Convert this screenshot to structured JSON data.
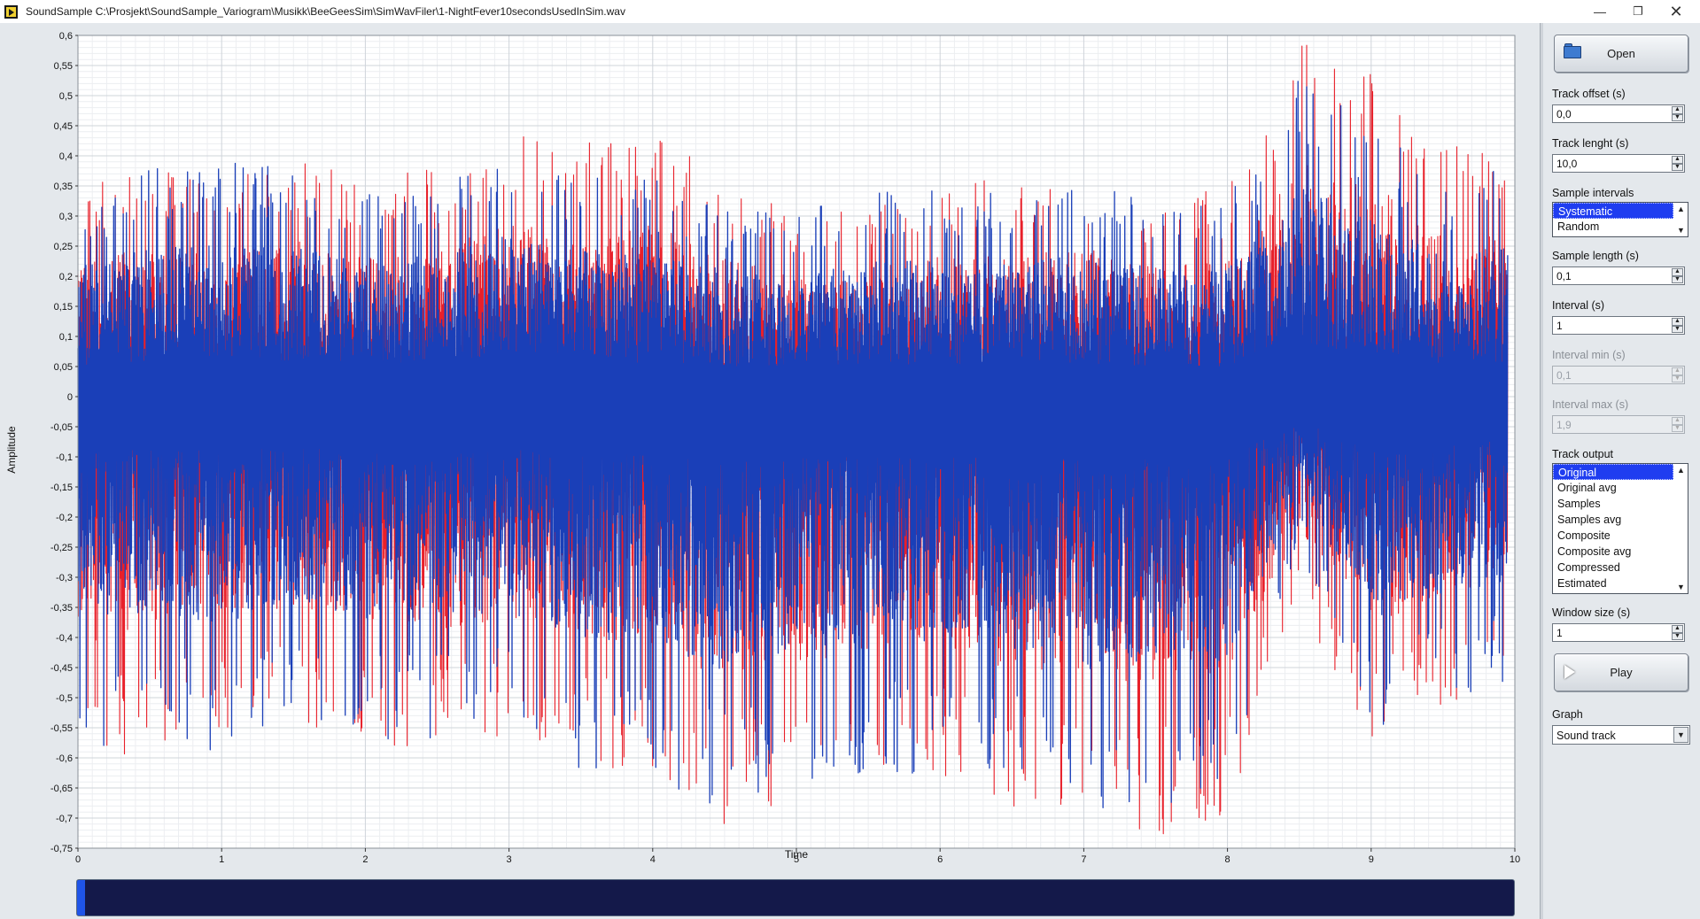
{
  "window": {
    "title": "SoundSample C:\\Prosjekt\\SoundSample_Variogram\\Musikk\\BeeGeesSim\\SimWavFiler\\1-NightFever10secondsUsedInSim.wav",
    "minimize_glyph": "—",
    "maximize_glyph": "❐",
    "close_glyph": "✕"
  },
  "controls": {
    "open_label": "Open",
    "open_icon": "folder-icon",
    "track_offset": {
      "label": "Track offset (s)",
      "value": "0,0"
    },
    "track_length": {
      "label": "Track lenght (s)",
      "value": "10,0"
    },
    "sample_intervals": {
      "label": "Sample intervals",
      "options": [
        "Systematic",
        "Random"
      ],
      "selected": "Systematic"
    },
    "sample_length": {
      "label": "Sample length (s)",
      "value": "0,1"
    },
    "interval": {
      "label": "Interval (s)",
      "value": "1"
    },
    "interval_min": {
      "label": "Interval min (s)",
      "value": "0,1",
      "disabled": true
    },
    "interval_max": {
      "label": "Interval max (s)",
      "value": "1,9",
      "disabled": true
    },
    "track_output": {
      "label": "Track output",
      "options": [
        "Original",
        "Original avg",
        "Samples",
        "Samples avg",
        "Composite",
        "Composite avg",
        "Compressed",
        "Estimated"
      ],
      "selected": "Original"
    },
    "window_size": {
      "label": "Window size (s)",
      "value": "1"
    },
    "play_label": "Play",
    "play_icon": "play-icon",
    "graph": {
      "label": "Graph",
      "value": "Sound track"
    },
    "spin_up": "▲",
    "spin_down": "▼",
    "list_up": "▲",
    "list_down": "▼"
  },
  "progress": {
    "fraction": 0.0
  },
  "colors": {
    "series_original": "#e8202a",
    "series_samples": "#1a3fb8",
    "plot_bg": "#ffffff",
    "grid": "#dde1e6",
    "progress_track": "#14194a",
    "progress_handle": "#1f54e8",
    "selection": "#1f3df0"
  },
  "chart_data": {
    "type": "line",
    "xlabel": "Time",
    "ylabel": "Amplitude",
    "xlim": [
      0,
      10
    ],
    "ylim": [
      -0.75,
      0.6
    ],
    "x_ticks": [
      "0",
      "1",
      "2",
      "3",
      "4",
      "5",
      "6",
      "7",
      "8",
      "9",
      "10"
    ],
    "y_ticks": [
      "0,6",
      "0,55",
      "0,5",
      "0,45",
      "0,4",
      "0,35",
      "0,3",
      "0,25",
      "0,2",
      "0,15",
      "0,1",
      "0,05",
      "0",
      "-0,05",
      "-0,1",
      "-0,15",
      "-0,2",
      "-0,25",
      "-0,3",
      "-0,35",
      "-0,4",
      "-0,45",
      "-0,5",
      "-0,55",
      "-0,6",
      "-0,65",
      "-0,7",
      "-0,75"
    ],
    "grid": true,
    "series": [
      {
        "color": "#e8202a",
        "envelope_x": [
          0,
          0.5,
          1,
          1.5,
          2,
          2.5,
          3,
          3.5,
          4,
          4.5,
          5,
          5.5,
          6,
          6.5,
          7,
          7.5,
          8,
          8.5,
          9,
          9.5,
          9.95
        ],
        "max": [
          0.35,
          0.38,
          0.36,
          0.4,
          0.36,
          0.38,
          0.44,
          0.42,
          0.44,
          0.36,
          0.3,
          0.33,
          0.36,
          0.36,
          0.38,
          0.33,
          0.35,
          0.6,
          0.55,
          0.42,
          0.41
        ],
        "min": [
          -0.64,
          -0.58,
          -0.55,
          -0.55,
          -0.57,
          -0.6,
          -0.57,
          -0.6,
          -0.65,
          -0.72,
          -0.68,
          -0.65,
          -0.63,
          -0.7,
          -0.72,
          -0.73,
          -0.7,
          -0.35,
          -0.58,
          -0.53,
          -0.43
        ]
      },
      {
        "color": "#1a3fb8",
        "envelope_x": [
          0,
          0.5,
          1,
          1.5,
          2,
          2.5,
          3,
          3.5,
          4,
          4.5,
          5,
          5.5,
          6,
          6.5,
          7,
          7.5,
          8,
          8.5,
          9,
          9.5,
          9.95
        ],
        "max": [
          0.33,
          0.38,
          0.4,
          0.38,
          0.36,
          0.36,
          0.42,
          0.38,
          0.36,
          0.33,
          0.3,
          0.35,
          0.35,
          0.35,
          0.36,
          0.33,
          0.33,
          0.55,
          0.46,
          0.36,
          0.38
        ],
        "min": [
          -0.6,
          -0.55,
          -0.6,
          -0.52,
          -0.57,
          -0.57,
          -0.55,
          -0.62,
          -0.63,
          -0.7,
          -0.65,
          -0.63,
          -0.63,
          -0.65,
          -0.7,
          -0.68,
          -0.68,
          -0.25,
          -0.57,
          -0.5,
          -0.48
        ]
      }
    ]
  }
}
